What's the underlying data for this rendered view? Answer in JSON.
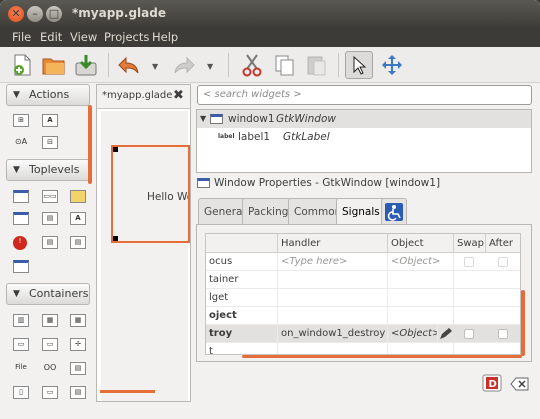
{
  "window": {
    "title": "*myapp.glade",
    "close_glyph": "✕",
    "min_glyph": "–",
    "max_glyph": "□"
  },
  "menubar": {
    "items": [
      "File",
      "Edit",
      "View",
      "Projects",
      "Help"
    ]
  },
  "toolbar": {
    "icons": [
      "new-icon",
      "open-icon",
      "save-icon",
      "undo-icon",
      "redo-icon",
      "cut-icon",
      "copy-icon",
      "paste-icon",
      "pointer-icon",
      "drag-resize-icon"
    ]
  },
  "palette": {
    "actions": {
      "label": "Actions"
    },
    "toplevels": {
      "label": "Toplevels"
    },
    "containers": {
      "label": "Containers"
    },
    "icon_labels": {
      "label_a": "A",
      "file": "File",
      "oo": "OO",
      "oa": "⊙A"
    }
  },
  "designer": {
    "tab_label": "*myapp.glade",
    "close_glyph": "✖",
    "preview_text": "Hello World"
  },
  "search": {
    "placeholder": "< search widgets >"
  },
  "inspector": {
    "rows": [
      {
        "name": "window1",
        "type": "GtkWindow",
        "toggle": "▼"
      },
      {
        "name": "label1",
        "type": "GtkLabel",
        "icon_text": "label"
      }
    ]
  },
  "properties": {
    "header": "Window Properties - GtkWindow [window1]",
    "tabs": [
      "General",
      "Packing",
      "Common",
      "Signals"
    ],
    "active_tab": "Signals"
  },
  "signals": {
    "columns": [
      "",
      "Handler",
      "Object",
      "Swap",
      "After"
    ],
    "rows": [
      {
        "signal": "ocus",
        "handler": "<Type here>",
        "object": "<Object>",
        "placeholder": true
      },
      {
        "signal": "tainer",
        "handler": "",
        "object": "",
        "placeholder": false
      },
      {
        "signal": "lget",
        "handler": "",
        "object": "",
        "placeholder": false
      },
      {
        "signal": "oject",
        "handler": "",
        "object": "",
        "placeholder": false,
        "bold": true
      },
      {
        "signal": "troy",
        "handler": "on_window1_destroy",
        "object": "<Object>",
        "placeholder": false,
        "bold": true,
        "selected": true
      },
      {
        "signal": "t",
        "handler": "",
        "object": "",
        "placeholder": false
      }
    ]
  },
  "colors": {
    "accent": "#e46d38",
    "titlebar": "#3c3b37",
    "selection": "#e2e1df"
  }
}
